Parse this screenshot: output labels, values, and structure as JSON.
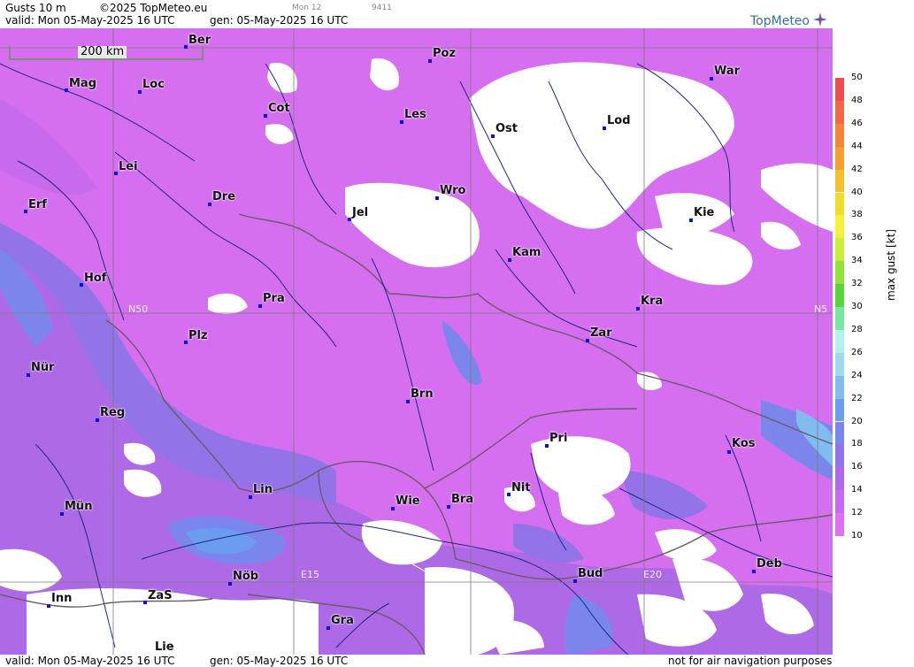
{
  "header": {
    "product": "Gusts 10 m",
    "copyright": "©2025 TopMeteo.eu",
    "valid": "valid:  Mon  05-May-2025  16 UTC",
    "generated": "gen: 05-May-2025 16 UTC",
    "run_small": "Mon 12",
    "id_small": "9411",
    "logo": "TopMeteo"
  },
  "footer": {
    "valid": "valid:  Mon  05-May-2025  16 UTC",
    "generated": "gen: 05-May-2025 16 UTC",
    "disclaimer": "not for air navigation purposes"
  },
  "scale_bar": "200 km",
  "grid_labels": [
    "N50",
    "N5",
    "E15",
    "E20"
  ],
  "cities": [
    {
      "name": "Ber"
    },
    {
      "name": "Poz"
    },
    {
      "name": "War"
    },
    {
      "name": "Mag"
    },
    {
      "name": "Loc"
    },
    {
      "name": "Cot"
    },
    {
      "name": "Les"
    },
    {
      "name": "Ost"
    },
    {
      "name": "Lod"
    },
    {
      "name": "Lei"
    },
    {
      "name": "Dre"
    },
    {
      "name": "Wro"
    },
    {
      "name": "Erf"
    },
    {
      "name": "Jel"
    },
    {
      "name": "Kie"
    },
    {
      "name": "Kam"
    },
    {
      "name": "Hof"
    },
    {
      "name": "Pra"
    },
    {
      "name": "Kra"
    },
    {
      "name": "Plz"
    },
    {
      "name": "Zar"
    },
    {
      "name": "Nür"
    },
    {
      "name": "Brn"
    },
    {
      "name": "Reg"
    },
    {
      "name": "Pri"
    },
    {
      "name": "Kos"
    },
    {
      "name": "Lin"
    },
    {
      "name": "Nit"
    },
    {
      "name": "Wie"
    },
    {
      "name": "Bra"
    },
    {
      "name": "Mün"
    },
    {
      "name": "Deb"
    },
    {
      "name": "Nöb"
    },
    {
      "name": "Bud"
    },
    {
      "name": "Inn"
    },
    {
      "name": "ZaS"
    },
    {
      "name": "Gra"
    },
    {
      "name": "Lie"
    }
  ],
  "legend": {
    "unit": "max  gust  [kt]",
    "levels": [
      {
        "value": "50",
        "color": "#e85050"
      },
      {
        "value": "48",
        "color": "#ee6a46"
      },
      {
        "value": "46",
        "color": "#f2843c"
      },
      {
        "value": "44",
        "color": "#f59e32"
      },
      {
        "value": "42",
        "color": "#f5c030"
      },
      {
        "value": "40",
        "color": "#f2dc30"
      },
      {
        "value": "38",
        "color": "#f5f040"
      },
      {
        "value": "36",
        "color": "#c8ee3c"
      },
      {
        "value": "34",
        "color": "#94e03c"
      },
      {
        "value": "32",
        "color": "#5cd23c"
      },
      {
        "value": "30",
        "color": "#7ae6a0"
      },
      {
        "value": "28",
        "color": "#b4f0f0"
      },
      {
        "value": "26",
        "color": "#a0d8f0"
      },
      {
        "value": "24",
        "color": "#80bcf0"
      },
      {
        "value": "22",
        "color": "#6c9cf0"
      },
      {
        "value": "20",
        "color": "#7a86ec"
      },
      {
        "value": "18",
        "color": "#9274e8"
      },
      {
        "value": "16",
        "color": "#ae6ae6"
      },
      {
        "value": "14",
        "color": "#c86aec"
      },
      {
        "value": "12",
        "color": "#de70f4"
      },
      {
        "value": "10",
        "color": "#ffffff"
      }
    ]
  }
}
